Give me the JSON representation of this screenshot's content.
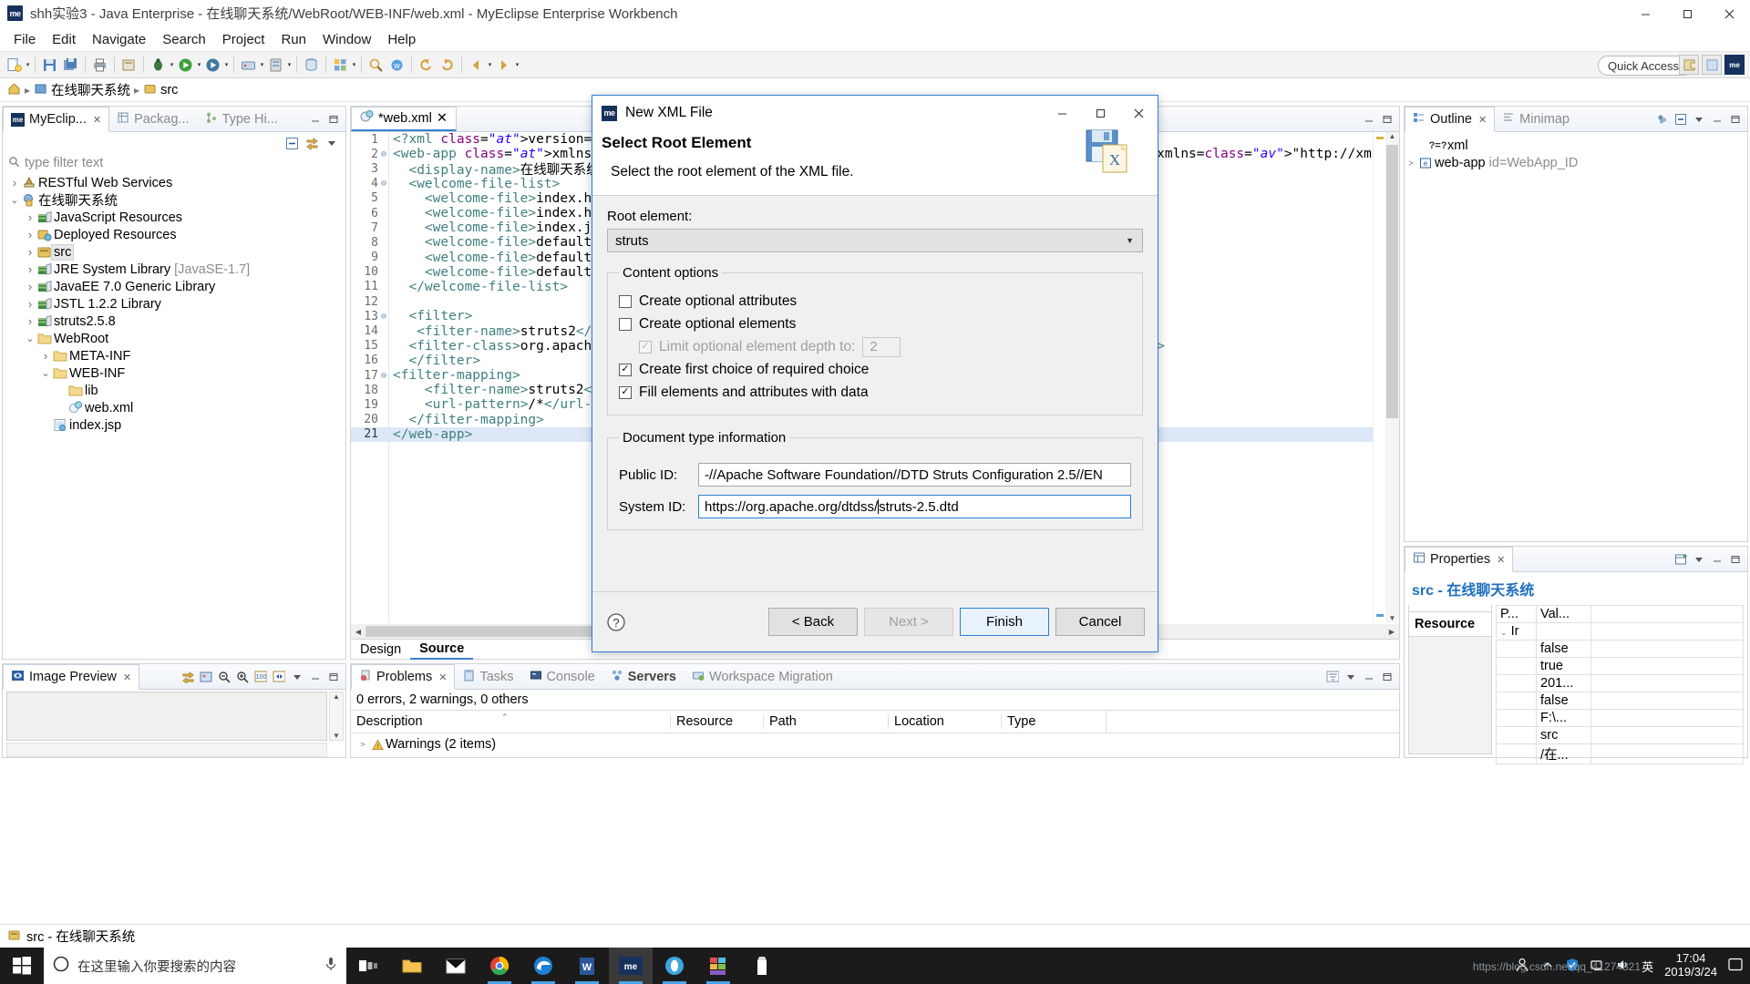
{
  "window": {
    "title": "shh实验3 - Java Enterprise - 在线聊天系统/WebRoot/WEB-INF/web.xml - MyEclipse Enterprise Workbench",
    "app_badge": "me",
    "minimize": "—",
    "maximize": "▫",
    "close": "✕"
  },
  "menubar": {
    "items": [
      "File",
      "Edit",
      "Navigate",
      "Search",
      "Project",
      "Run",
      "Window",
      "Help"
    ]
  },
  "toolbar": {
    "quick_access": "Quick Access",
    "perspective_me": "me"
  },
  "breadcrumb": {
    "project": "在线聊天系统",
    "node": "src"
  },
  "explorer": {
    "tabs": [
      {
        "label": "MyEclip...",
        "icon": "myeclipse-icon",
        "active": true,
        "closable": true
      },
      {
        "label": "Packag...",
        "icon": "package-explorer-icon",
        "active": false
      },
      {
        "label": "Type Hi...",
        "icon": "type-hierarchy-icon",
        "active": false
      }
    ],
    "filter_placeholder": "type filter text",
    "tree": [
      {
        "label": "RESTful Web Services",
        "indent": 0,
        "twisty": ">",
        "icon": "restful-icon",
        "selected": false
      },
      {
        "label": "在线聊天系统",
        "indent": 0,
        "twisty": "v",
        "icon": "project-icon",
        "selected": false
      },
      {
        "label": "JavaScript Resources",
        "indent": 1,
        "twisty": ">",
        "icon": "library-icon",
        "selected": false
      },
      {
        "label": "Deployed Resources",
        "indent": 1,
        "twisty": ">",
        "icon": "deployed-icon",
        "selected": false
      },
      {
        "label": "src",
        "indent": 1,
        "twisty": ">",
        "icon": "source-folder-icon",
        "selected": true
      },
      {
        "label": "JRE System Library",
        "suffix": "[JavaSE-1.7]",
        "indent": 1,
        "twisty": ">",
        "icon": "library-icon",
        "selected": false
      },
      {
        "label": "JavaEE 7.0 Generic Library",
        "indent": 1,
        "twisty": ">",
        "icon": "library-icon",
        "selected": false
      },
      {
        "label": "JSTL 1.2.2 Library",
        "indent": 1,
        "twisty": ">",
        "icon": "library-icon",
        "selected": false
      },
      {
        "label": "struts2.5.8",
        "indent": 1,
        "twisty": ">",
        "icon": "library-icon",
        "selected": false
      },
      {
        "label": "WebRoot",
        "indent": 1,
        "twisty": "v",
        "icon": "folder-icon",
        "selected": false
      },
      {
        "label": "META-INF",
        "indent": 2,
        "twisty": ">",
        "icon": "folder-icon",
        "selected": false
      },
      {
        "label": "WEB-INF",
        "indent": 2,
        "twisty": "v",
        "icon": "folder-icon",
        "selected": false
      },
      {
        "label": "lib",
        "indent": 3,
        "twisty": "",
        "icon": "folder-icon",
        "selected": false
      },
      {
        "label": "web.xml",
        "indent": 3,
        "twisty": "",
        "icon": "xml-file-icon",
        "selected": false
      },
      {
        "label": "index.jsp",
        "indent": 2,
        "twisty": "",
        "icon": "jsp-file-icon",
        "selected": false
      }
    ]
  },
  "editor": {
    "tab_label": "*web.xml",
    "tab_icon": "xml-file-icon",
    "bottom_tabs": [
      {
        "label": "Design",
        "active": false
      },
      {
        "label": "Source",
        "active": true
      }
    ],
    "lines": [
      {
        "n": 1,
        "fold": "",
        "text": "<?xml version=\"1.0\" encoding=\"UTF-8\"?>"
      },
      {
        "n": 2,
        "fold": "⊖",
        "text": "<web-app xmlns:xsi=\"http://www.w3.org/2001/XMLSchema-instance\" xmlns=\"http://xmlns.jcp.org/xml/ns/javaee\" xsi:schemaLo"
      },
      {
        "n": 3,
        "fold": "",
        "text": "  <display-name>在线聊天系统</display-name>"
      },
      {
        "n": 4,
        "fold": "⊖",
        "text": "  <welcome-file-list>"
      },
      {
        "n": 5,
        "fold": "",
        "text": "    <welcome-file>index.html</welcome-file>"
      },
      {
        "n": 6,
        "fold": "",
        "text": "    <welcome-file>index.htm</welcome-file>"
      },
      {
        "n": 7,
        "fold": "",
        "text": "    <welcome-file>index.jsp</welcome-file>"
      },
      {
        "n": 8,
        "fold": "",
        "text": "    <welcome-file>default.html</welcome-file>"
      },
      {
        "n": 9,
        "fold": "",
        "text": "    <welcome-file>default.htm</welcome-file>"
      },
      {
        "n": 10,
        "fold": "",
        "text": "    <welcome-file>default.jsp</welcome-file>"
      },
      {
        "n": 11,
        "fold": "",
        "text": "  </welcome-file-list>"
      },
      {
        "n": 12,
        "fold": "",
        "text": ""
      },
      {
        "n": 13,
        "fold": "⊖",
        "text": "  <filter>"
      },
      {
        "n": 14,
        "fold": "",
        "text": "   <filter-name>struts2</filter-name>"
      },
      {
        "n": 15,
        "fold": "",
        "text": "  <filter-class>org.apache.struts2.dispatcher.filter.StrutsPrepareAndExecuteFilter</filter-class>"
      },
      {
        "n": 16,
        "fold": "",
        "text": "  </filter>"
      },
      {
        "n": 17,
        "fold": "⊖",
        "text": "<filter-mapping>"
      },
      {
        "n": 18,
        "fold": "",
        "text": "    <filter-name>struts2</filter-name>"
      },
      {
        "n": 19,
        "fold": "",
        "text": "    <url-pattern>/*</url-pattern>"
      },
      {
        "n": 20,
        "fold": "",
        "text": "  </filter-mapping>"
      },
      {
        "n": 21,
        "fold": "",
        "text": "</web-app>",
        "current": true
      }
    ]
  },
  "outline": {
    "tabs": [
      {
        "label": "Outline",
        "active": true,
        "icon": "outline-icon",
        "closable": true
      },
      {
        "label": "Minimap",
        "active": false,
        "icon": "minimap-icon"
      }
    ],
    "items": [
      {
        "label": "xml",
        "icon": "pi-icon",
        "twisty": ""
      },
      {
        "label": "web-app",
        "suffix": "id=WebApp_ID",
        "icon": "element-icon",
        "twisty": ">"
      }
    ]
  },
  "properties": {
    "tab_label": "Properties",
    "heading": "src - 在线聊天系统",
    "section": "Resource",
    "columns": [
      "P...",
      "Val..."
    ],
    "rows": [
      {
        "prop": "Ir",
        "value": "",
        "twisty": "v"
      },
      {
        "prop": "",
        "value": "false"
      },
      {
        "prop": "",
        "value": "true"
      },
      {
        "prop": "",
        "value": "201..."
      },
      {
        "prop": "",
        "value": "false"
      },
      {
        "prop": "",
        "value": "F:\\..."
      },
      {
        "prop": "",
        "value": "src"
      },
      {
        "prop": "",
        "value": "/在..."
      }
    ]
  },
  "image_preview": {
    "tab_label": "Image Preview"
  },
  "problems": {
    "tabs": [
      {
        "label": "Problems",
        "active": true,
        "icon": "problems-icon",
        "closable": true
      },
      {
        "label": "Tasks",
        "active": false,
        "icon": "tasks-icon"
      },
      {
        "label": "Console",
        "active": false,
        "icon": "console-icon"
      },
      {
        "label": "Servers",
        "active": false,
        "icon": "servers-icon",
        "bold": true
      },
      {
        "label": "Workspace Migration",
        "active": false,
        "icon": "migration-icon"
      }
    ],
    "summary": "0 errors, 2 warnings, 0 others",
    "columns": [
      "Description",
      "Resource",
      "Path",
      "Location",
      "Type"
    ],
    "rows": [
      {
        "description": "Warnings (2 items)",
        "resource": "",
        "path": "",
        "location": "",
        "type": "",
        "twisty": ">",
        "icon": "warning-icon"
      }
    ]
  },
  "statusbar": {
    "text": "src - 在线聊天系统",
    "icon": "source-folder-icon"
  },
  "dialog": {
    "title": "New XML File",
    "badge": "me",
    "heading": "Select Root Element",
    "subheading": "Select the root element of the XML file.",
    "root_element_label": "Root element:",
    "root_element_value": "struts",
    "content_options_legend": "Content options",
    "options": [
      {
        "label": "Create optional attributes",
        "checked": false,
        "disabled": false,
        "indent": false
      },
      {
        "label": "Create optional elements",
        "checked": false,
        "disabled": false,
        "indent": false
      },
      {
        "label": "Limit optional element depth to:",
        "checked": true,
        "disabled": true,
        "indent": true,
        "spinner": "2"
      },
      {
        "label": "Create first choice of required choice",
        "checked": true,
        "disabled": false,
        "indent": false
      },
      {
        "label": "Fill elements and attributes with data",
        "checked": true,
        "disabled": false,
        "indent": false
      }
    ],
    "doctype_legend": "Document type information",
    "public_id_label": "Public ID:",
    "public_id_value": "-//Apache Software Foundation//DTD Struts Configuration 2.5//EN",
    "system_id_label": "System ID:",
    "system_id_value_before": "https://org.apache.org/dtdss/",
    "system_id_value_after": "struts-2.5.dtd",
    "buttons": [
      {
        "label": "< Back",
        "state": "normal",
        "name": "back-button"
      },
      {
        "label": "Next >",
        "state": "disabled",
        "name": "next-button"
      },
      {
        "label": "Finish",
        "state": "default",
        "name": "finish-button"
      },
      {
        "label": "Cancel",
        "state": "normal",
        "name": "cancel-button"
      }
    ],
    "help_icon": "help-icon",
    "minimize": "—",
    "maximize": "▫",
    "close": "✕"
  },
  "taskbar": {
    "search_placeholder": "在这里输入你要搜索的内容",
    "clock_time": "17:04",
    "clock_date": "2019/3/24",
    "watermark": "https://blog.csdn.net/qq_41274821",
    "items": [
      {
        "name": "task-view",
        "glyph": "⊞",
        "running": false
      },
      {
        "name": "file-explorer",
        "glyph": "📁",
        "running": false
      },
      {
        "name": "mail",
        "glyph": "✉",
        "running": false
      },
      {
        "name": "chrome",
        "glyph": "◉",
        "running": true
      },
      {
        "name": "edge",
        "glyph": "e",
        "running": true
      },
      {
        "name": "word",
        "glyph": "W",
        "running": true
      },
      {
        "name": "myeclipse",
        "glyph": "me",
        "running": true,
        "active": true
      },
      {
        "name": "tomcat",
        "glyph": "🐱",
        "running": true
      },
      {
        "name": "app-grid",
        "glyph": "▦",
        "running": true
      },
      {
        "name": "recorder",
        "glyph": "▮",
        "running": false
      }
    ]
  },
  "colors": {
    "accent": "#2a7fd4",
    "tab_blue": "#3b7fd4",
    "prop_heading": "#1f6fbf",
    "xml_tag": "#3f7f7f",
    "xml_attr": "#7f007f",
    "xml_value": "#2a00ff"
  }
}
